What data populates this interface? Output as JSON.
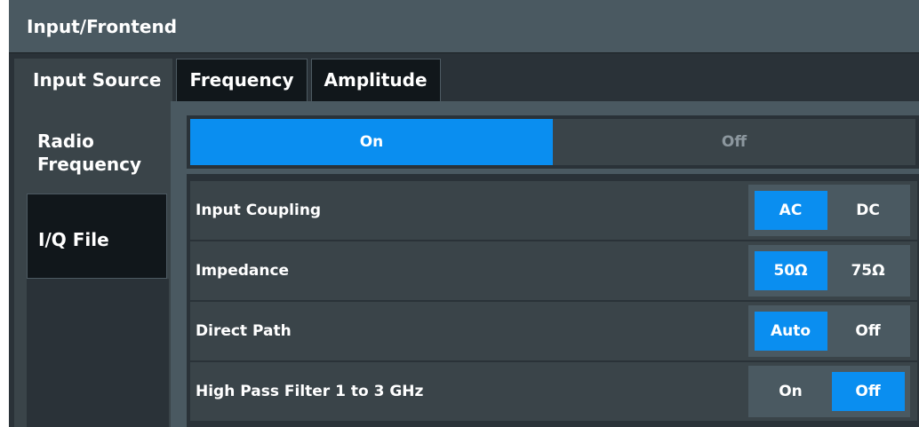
{
  "title": "Input/Frontend",
  "tabs": [
    "Input Source",
    "Frequency",
    "Amplitude"
  ],
  "side_tabs": {
    "radio_frequency": "Radio\nFrequency",
    "iq_file": "I/Q File"
  },
  "rf_state": {
    "on": "On",
    "off": "Off",
    "selected": "On"
  },
  "settings": [
    {
      "label": "Input Coupling",
      "options": [
        "AC",
        "DC"
      ],
      "selected": "AC"
    },
    {
      "label": "Impedance",
      "options": [
        "50Ω",
        "75Ω"
      ],
      "selected": "50Ω"
    },
    {
      "label": "Direct Path",
      "options": [
        "Auto",
        "Off"
      ],
      "selected": "Auto"
    },
    {
      "label": "High Pass Filter 1 to 3 GHz",
      "options": [
        "On",
        "Off"
      ],
      "selected": "Off"
    }
  ],
  "colors": {
    "accent": "#0a8ef0",
    "title_bg": "#4a5961",
    "background": "#2a3238"
  }
}
